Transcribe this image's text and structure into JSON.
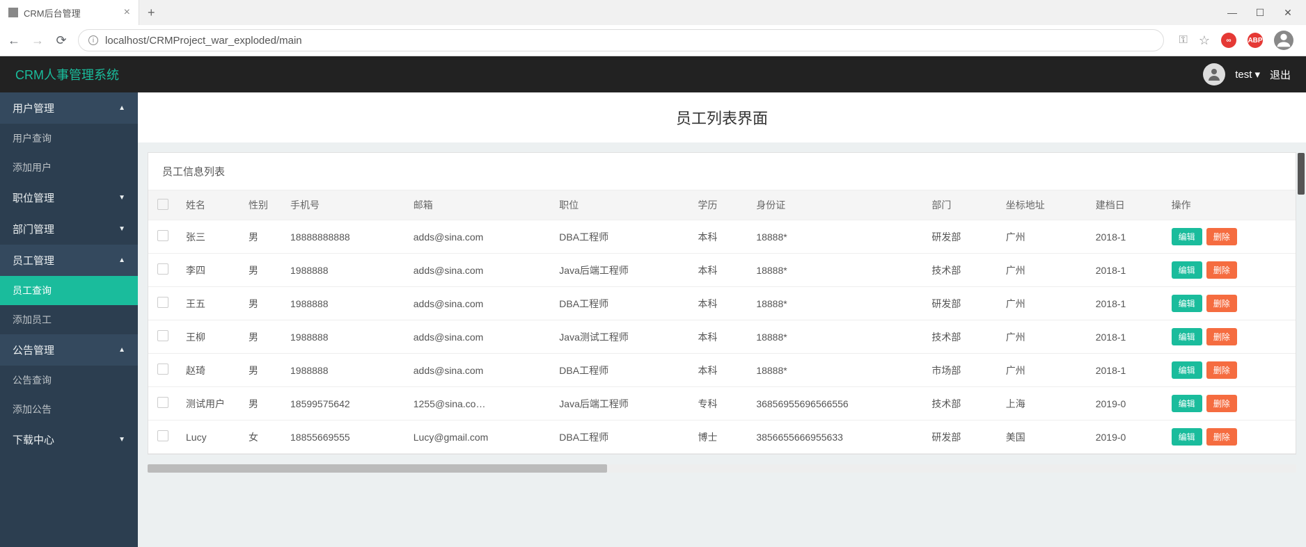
{
  "browser": {
    "tab_title": "CRM后台管理",
    "url": "localhost/CRMProject_war_exploded/main"
  },
  "header": {
    "brand": "CRM人事管理系统",
    "user": "test",
    "logout": "退出"
  },
  "sidebar": {
    "groups": [
      {
        "label": "用户管理",
        "expanded": true,
        "items": [
          "用户查询",
          "添加用户"
        ],
        "active": null
      },
      {
        "label": "职位管理",
        "expanded": false,
        "items": [],
        "active": null
      },
      {
        "label": "部门管理",
        "expanded": false,
        "items": [],
        "active": null
      },
      {
        "label": "员工管理",
        "expanded": true,
        "items": [
          "员工查询",
          "添加员工"
        ],
        "active": "员工查询"
      },
      {
        "label": "公告管理",
        "expanded": true,
        "items": [
          "公告查询",
          "添加公告"
        ],
        "active": null
      },
      {
        "label": "下载中心",
        "expanded": false,
        "items": [],
        "active": null
      }
    ]
  },
  "page": {
    "title": "员工列表界面",
    "panel_title": "员工信息列表"
  },
  "table": {
    "columns": [
      "姓名",
      "性别",
      "手机号",
      "邮箱",
      "职位",
      "学历",
      "身份证",
      "部门",
      "坐标地址",
      "建档日",
      "操作"
    ],
    "edit_label": "编辑",
    "delete_label": "删除",
    "rows": [
      {
        "name": "张三",
        "gender": "男",
        "phone": "18888888888",
        "email": "adds@sina.com",
        "position": "DBA工程师",
        "edu": "本科",
        "idcard": "18888*",
        "dept": "研发部",
        "addr": "广州",
        "date": "2018-1"
      },
      {
        "name": "李四",
        "gender": "男",
        "phone": "1988888",
        "email": "adds@sina.com",
        "position": "Java后端工程师",
        "edu": "本科",
        "idcard": "18888*",
        "dept": "技术部",
        "addr": "广州",
        "date": "2018-1"
      },
      {
        "name": "王五",
        "gender": "男",
        "phone": "1988888",
        "email": "adds@sina.com",
        "position": "DBA工程师",
        "edu": "本科",
        "idcard": "18888*",
        "dept": "研发部",
        "addr": "广州",
        "date": "2018-1"
      },
      {
        "name": "王柳",
        "gender": "男",
        "phone": "1988888",
        "email": "adds@sina.com",
        "position": "Java测试工程师",
        "edu": "本科",
        "idcard": "18888*",
        "dept": "技术部",
        "addr": "广州",
        "date": "2018-1"
      },
      {
        "name": "赵琦",
        "gender": "男",
        "phone": "1988888",
        "email": "adds@sina.com",
        "position": "DBA工程师",
        "edu": "本科",
        "idcard": "18888*",
        "dept": "市场部",
        "addr": "广州",
        "date": "2018-1"
      },
      {
        "name": "测试用户",
        "gender": "男",
        "phone": "18599575642",
        "email": "1255@sina.co…",
        "position": "Java后端工程师",
        "edu": "专科",
        "idcard": "36856955696566556",
        "dept": "技术部",
        "addr": "上海",
        "date": "2019-0"
      },
      {
        "name": "Lucy",
        "gender": "女",
        "phone": "18855669555",
        "email": "Lucy@gmail.com",
        "position": "DBA工程师",
        "edu": "博士",
        "idcard": "3856655666955633",
        "dept": "研发部",
        "addr": "美国",
        "date": "2019-0"
      }
    ]
  }
}
